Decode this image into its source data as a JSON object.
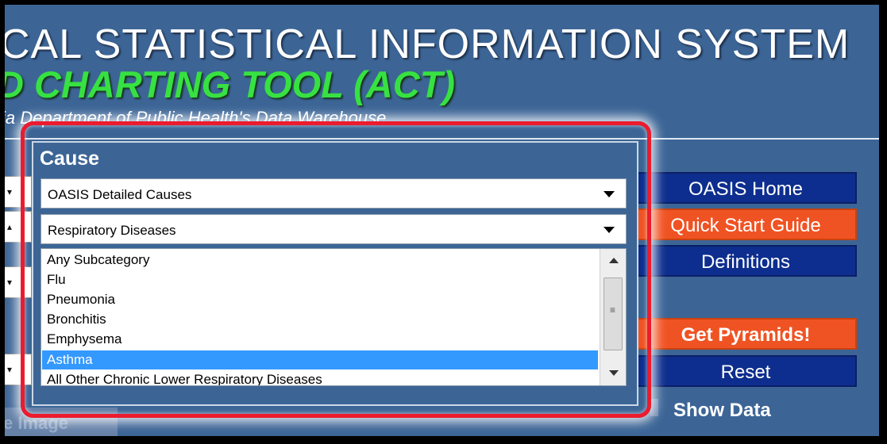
{
  "header": {
    "title_line1": "CAL STATISTICAL INFORMATION SYSTEM",
    "title_line2": "D CHARTING TOOL (ACT)",
    "subtitle": "ia Department of Public Health's Data Warehouse"
  },
  "background_label": "e Image",
  "cause_panel": {
    "title": "Cause",
    "category_select": {
      "selected": "OASIS Detailed Causes"
    },
    "subcategory_select": {
      "selected": "Respiratory Diseases"
    },
    "list_items": [
      "Any Subcategory",
      "Flu",
      "Pneumonia",
      "Bronchitis",
      "Emphysema",
      "Asthma",
      "All Other Chronic Lower Respiratory Diseases"
    ],
    "selected_item": "Asthma"
  },
  "nav": {
    "oasis_home": "OASIS Home",
    "quick_start": "Quick Start Guide",
    "definitions": "Definitions",
    "get_pyramids": "Get Pyramids!",
    "reset": "Reset",
    "show_data": "Show Data"
  },
  "colors": {
    "page_bg": "#3c6596",
    "title_green": "#37e142",
    "nav_blue": "#0d2e8e",
    "nav_orange": "#f05323",
    "highlight_red": "#ec1b2e",
    "selection_blue": "#3399ff"
  },
  "icons": {
    "dropdown": "chevron-down-icon",
    "scroll_up": "scroll-up-arrow-icon",
    "scroll_down": "scroll-down-arrow-icon"
  }
}
